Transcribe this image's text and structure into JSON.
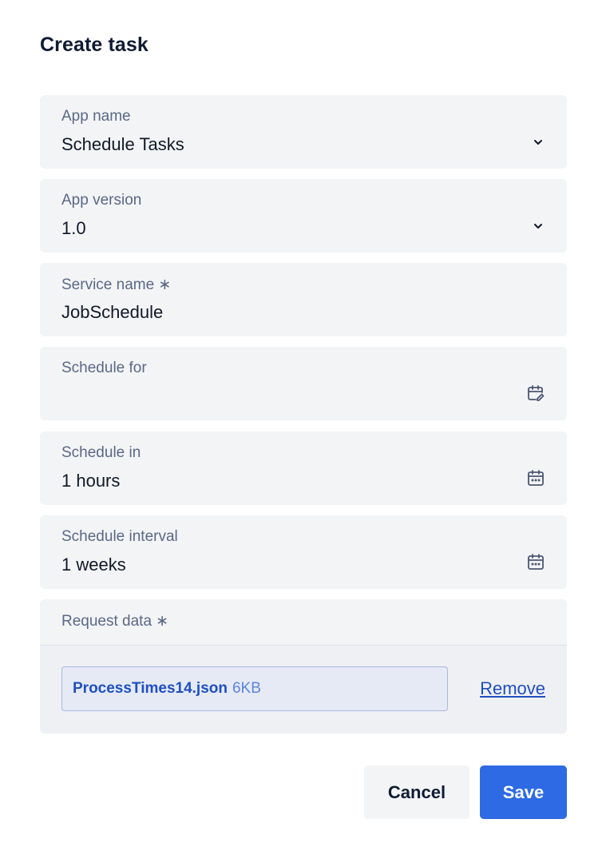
{
  "dialog": {
    "title": "Create task"
  },
  "fields": {
    "app_name": {
      "label": "App name",
      "value": "Schedule Tasks",
      "icon": "chevron-down-icon"
    },
    "app_version": {
      "label": "App version",
      "value": "1.0",
      "icon": "chevron-down-icon"
    },
    "service_name": {
      "label": "Service name ∗",
      "value": "JobSchedule"
    },
    "schedule_for": {
      "label": "Schedule for",
      "value": "",
      "icon": "calendar-edit-icon"
    },
    "schedule_in": {
      "label": "Schedule in",
      "value": "1 hours",
      "icon": "calendar-icon"
    },
    "schedule_interval": {
      "label": "Schedule interval",
      "value": "1 weeks",
      "icon": "calendar-icon"
    }
  },
  "request_data": {
    "label": "Request data ∗",
    "file_name": "ProcessTimes14.json",
    "file_size": "6KB",
    "remove_label": "Remove"
  },
  "actions": {
    "cancel_label": "Cancel",
    "save_label": "Save"
  },
  "colors": {
    "primary": "#2d6ae3",
    "field_bg": "#f3f4f6",
    "label": "#5a6886",
    "link": "#1f4fbf"
  }
}
